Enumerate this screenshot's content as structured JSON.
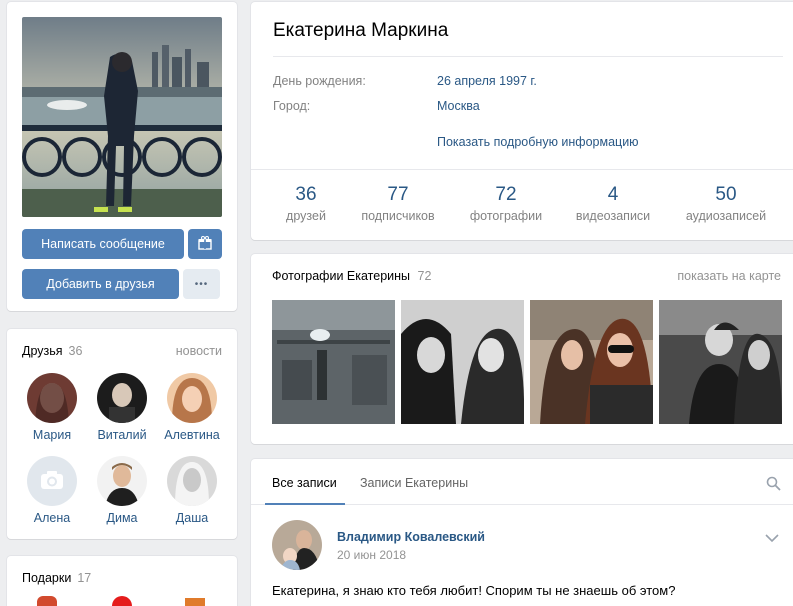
{
  "profile": {
    "name": "Екатерина Маркина",
    "send_message_label": "Написать сообщение",
    "add_friend_label": "Добавить в друзья",
    "more_label": "•••",
    "info": [
      {
        "label": "День рождения:",
        "value": "26 апреля 1997 г."
      },
      {
        "label": "Город:",
        "value": "Москва"
      }
    ],
    "more_info_label": "Показать подробную информацию",
    "counters": [
      {
        "value": "36",
        "label": "друзей"
      },
      {
        "value": "77",
        "label": "подписчиков"
      },
      {
        "value": "72",
        "label": "фотографии"
      },
      {
        "value": "4",
        "label": "видеозаписи"
      },
      {
        "value": "50",
        "label": "аудиозаписей"
      }
    ]
  },
  "friends": {
    "title": "Друзья",
    "count": "36",
    "link": "новости",
    "items": [
      {
        "name": "Мария"
      },
      {
        "name": "Виталий"
      },
      {
        "name": "Алевтина"
      },
      {
        "name": "Алена"
      },
      {
        "name": "Дима"
      },
      {
        "name": "Даша"
      }
    ]
  },
  "gifts": {
    "title": "Подарки",
    "count": "17"
  },
  "photos": {
    "title": "Фотографии Екатерины",
    "count": "72",
    "map_link": "показать на карте"
  },
  "wall": {
    "tabs": [
      {
        "label": "Все записи"
      },
      {
        "label": "Записи Екатерины"
      }
    ],
    "post": {
      "author": "Владимир Ковалевский",
      "date": "20 июн 2018",
      "text": "Екатерина, я знаю кто тебя любит! Спорим ты не знаешь об этом?"
    }
  },
  "colors": {
    "accent": "#5181b8",
    "link": "#2a5885",
    "background": "#edeef0"
  }
}
